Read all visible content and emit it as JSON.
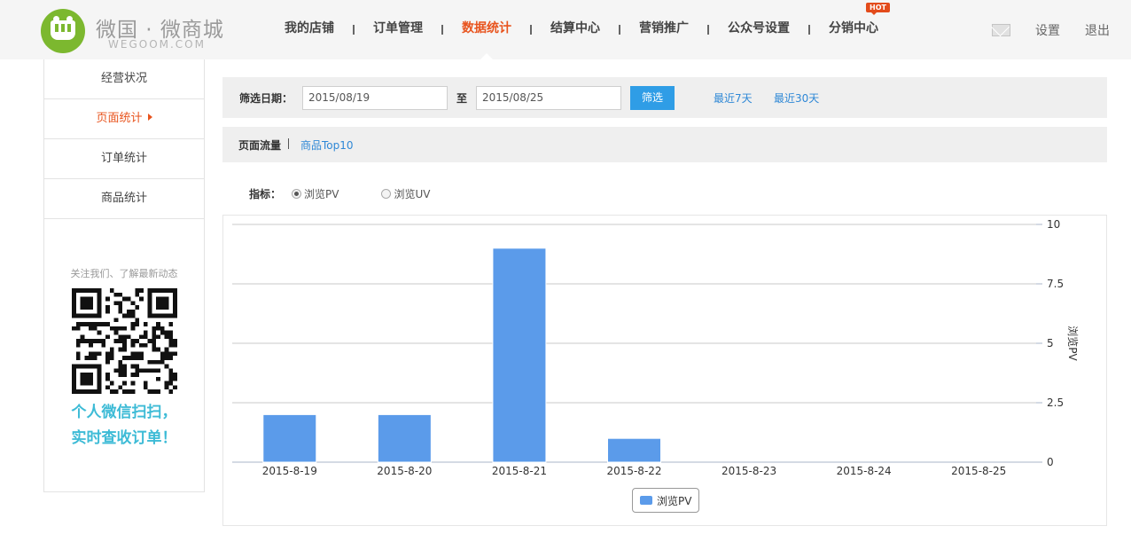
{
  "brand": {
    "name": "微国 · 微商城",
    "sub": "WEGOOM.COM",
    "color": "#7cb82f"
  },
  "nav": {
    "items": [
      {
        "label": "我的店铺"
      },
      {
        "label": "订单管理"
      },
      {
        "label": "数据统计",
        "active": true
      },
      {
        "label": "结算中心"
      },
      {
        "label": "营销推广"
      },
      {
        "label": "公众号设置"
      },
      {
        "label": "分销中心",
        "badge": "HOT"
      }
    ],
    "active_color": "#e8541e"
  },
  "header_right": {
    "settings": "设置",
    "logout": "退出"
  },
  "sidebar": {
    "items": [
      {
        "label": "经营状况"
      },
      {
        "label": "页面统计",
        "active": true
      },
      {
        "label": "订单统计"
      },
      {
        "label": "商品统计"
      }
    ],
    "follow_text": "关注我们、了解最新动态",
    "promo_line1": "个人微信扫扫，",
    "promo_line2": "实时查收订单！"
  },
  "filter": {
    "label": "筛选日期：",
    "start_date": "2015/08/19",
    "to_label": "至",
    "end_date": "2015/08/25",
    "button": "筛选",
    "quick_7": "最近7天",
    "quick_30": "最近30天"
  },
  "tabs": {
    "active": "页面流量",
    "other": "商品Top10"
  },
  "metric": {
    "label": "指标：",
    "options": [
      {
        "label": "浏览PV",
        "selected": true
      },
      {
        "label": "浏览UV",
        "selected": false
      }
    ]
  },
  "chart_data": {
    "type": "bar",
    "categories": [
      "2015-8-19",
      "2015-8-20",
      "2015-8-21",
      "2015-8-22",
      "2015-8-23",
      "2015-8-24",
      "2015-8-25"
    ],
    "series": [
      {
        "name": "浏览PV",
        "values": [
          2,
          2,
          9,
          1,
          0,
          0,
          0
        ],
        "color": "#5b9bea"
      }
    ],
    "ylabel": "浏览PV",
    "y_axis_position": "right",
    "ylim": [
      0,
      10
    ],
    "yticks": [
      "0",
      "2.5",
      "5",
      "7.5",
      "10"
    ],
    "grid": true,
    "legend": "bottom-center"
  }
}
